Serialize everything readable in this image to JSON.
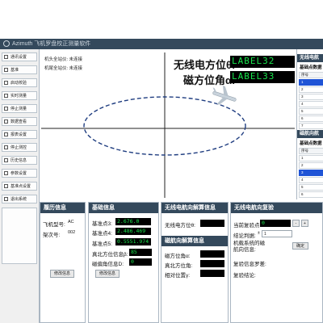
{
  "app": {
    "title": "Azimuth 飞机罗盘校正测量软件"
  },
  "sidebar": {
    "items": [
      {
        "label": "通讯设置"
      },
      {
        "label": "基准"
      },
      {
        "label": "启动校验"
      },
      {
        "label": "实时测量"
      },
      {
        "label": "停止测量"
      },
      {
        "label": "数据查看"
      },
      {
        "label": "报表设置"
      },
      {
        "label": "停止测控"
      },
      {
        "label": "历史信息"
      },
      {
        "label": "参数设置"
      },
      {
        "label": "基准点设置"
      },
      {
        "label": "退出系统"
      }
    ]
  },
  "plot": {
    "head_line": "机头全站仪: 未连接",
    "tail_line": "机尾全站仪: 未连接",
    "radio_label": "无线电方位θ:",
    "radio_value": "LABEL32",
    "mag_label": "磁方位角α:",
    "mag_value": "LABEL33"
  },
  "right_panel": {
    "radio_title": "无线电航",
    "radio_sub": "基础点数据",
    "radio_col": "序号",
    "radio_rows": [
      "1",
      "2",
      "3",
      "4",
      "5",
      "6",
      "7"
    ],
    "radio_selected": 0,
    "mag_title": "磁航向航",
    "mag_sub": "基础点数据",
    "mag_col": "序号",
    "mag_rows": [
      "1",
      "2",
      "3",
      "4",
      "5",
      "6"
    ],
    "mag_selected": 2
  },
  "resume": {
    "title": "履历信息",
    "model_label": "飞机型号:",
    "model_value": "AC",
    "rack_label": "架次号:",
    "rack_value": "002",
    "edit_button": "修改信息"
  },
  "basic": {
    "title": "基础信息",
    "p3_label": "基准点3:",
    "p3_value": "2.676.0",
    "p4_label": "基准点4:",
    "p4_value": "2.486.469",
    "p5_label": "基准点5:",
    "p5_value": "0.5551.974",
    "beta_label": "真北方位信息β:",
    "beta_value": "85",
    "d_label": "磁偏角信息D:",
    "d_value": "0",
    "edit_button": "修改信息"
  },
  "radio_result": {
    "title": "无线电航向解算信息",
    "theta_label": "无线电方位θ:"
  },
  "mag_result": {
    "title": "磁航向解算信息",
    "alpha_label": "磁方位角α:",
    "north_label": "真北方位角:",
    "rel_label": "相对位置γ:"
  },
  "recheck": {
    "title": "无线电航向复验",
    "current_label": "当前复验点:",
    "current_value": "0",
    "minus": "-",
    "plus": "+",
    "judge_label": "结论判据:",
    "judge_prefix": "±",
    "judge_value": "1",
    "status_label": "机载系统的磁航向信息:",
    "confirm_button": "确定",
    "error_label": "复验信息罗差:",
    "result_label": "复验结论:"
  },
  "colors": {
    "header_bg": "#34495c",
    "lcd_green": "#19e34c",
    "selection_blue": "#1f54d6"
  }
}
